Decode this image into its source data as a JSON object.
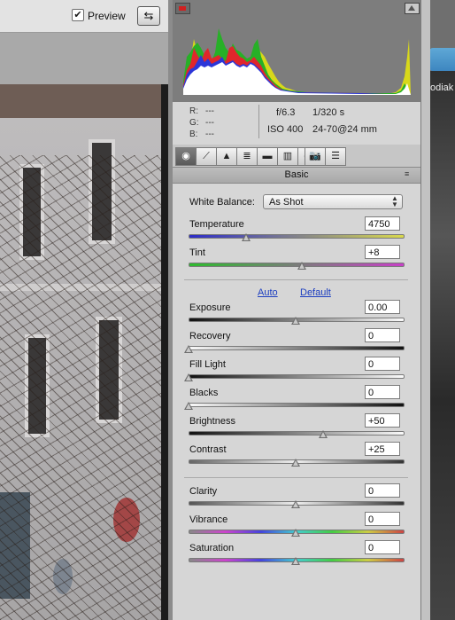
{
  "toolbar": {
    "preview_label": "Preview",
    "preview_checked": "✔",
    "swap_icon": "⇆"
  },
  "info": {
    "r_label": "R:",
    "g_label": "G:",
    "b_label": "B:",
    "r_value": "---",
    "g_value": "---",
    "b_value": "---",
    "aperture": "f/6.3",
    "shutter": "1/320 s",
    "iso": "ISO 400",
    "lens": "24-70@24 mm"
  },
  "tabs": [
    "◉",
    "⟋",
    "▲",
    "≣",
    "▬",
    "▥",
    "◍",
    "📷",
    "☰"
  ],
  "panel": {
    "title": "Basic",
    "menu_icon": "≡",
    "white_balance_label": "White Balance:",
    "white_balance_value": "As Shot",
    "auto_label": "Auto",
    "default_label": "Default"
  },
  "sliders": {
    "temperature": {
      "label": "Temperature",
      "value": "4750",
      "level": 0.27
    },
    "tint": {
      "label": "Tint",
      "value": "+8",
      "level": 0.53
    },
    "exposure": {
      "label": "Exposure",
      "value": "0.00",
      "level": 0.5
    },
    "recovery": {
      "label": "Recovery",
      "value": "0",
      "level": 0.0
    },
    "fill_light": {
      "label": "Fill Light",
      "value": "0",
      "level": 0.0
    },
    "blacks": {
      "label": "Blacks",
      "value": "0",
      "level": 0.0
    },
    "brightness": {
      "label": "Brightness",
      "value": "+50",
      "level": 0.63
    },
    "contrast": {
      "label": "Contrast",
      "value": "+25",
      "level": 0.5
    },
    "clarity": {
      "label": "Clarity",
      "value": "0",
      "level": 0.5
    },
    "vibrance": {
      "label": "Vibrance",
      "value": "0",
      "level": 0.5
    },
    "saturation": {
      "label": "Saturation",
      "value": "0",
      "level": 0.5
    }
  },
  "right_panel": {
    "partial_text": "odiak"
  },
  "colors": {
    "panel_bg": "#d6d6d6",
    "histogram_bg": "#7d7d7d",
    "link": "#1d3fc0",
    "right_accent": "#4a93c9"
  }
}
